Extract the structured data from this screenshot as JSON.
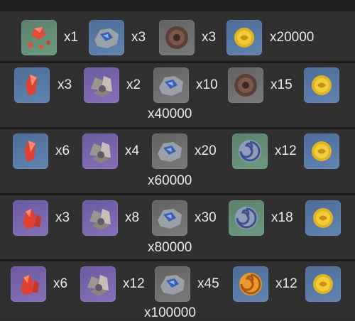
{
  "rows": [
    {
      "items": [
        {
          "icon": "gem-fragments-icon",
          "qty": "x1"
        },
        {
          "icon": "ore-chunk-icon",
          "qty": "x3"
        },
        {
          "icon": "brown-disc-icon",
          "qty": "x3"
        },
        {
          "icon": "mora-coin-icon",
          "qty": "x20000"
        }
      ]
    },
    {
      "items": [
        {
          "icon": "red-crystal-icon",
          "qty": "x3"
        },
        {
          "icon": "grey-ore-icon",
          "qty": "x2"
        },
        {
          "icon": "ore-chunk-icon",
          "qty": "x10"
        },
        {
          "icon": "brown-disc-icon",
          "qty": "x15"
        },
        {
          "icon": "mora-coin-icon",
          "qty": ""
        }
      ],
      "mora": "x40000"
    },
    {
      "items": [
        {
          "icon": "red-crystal-icon",
          "qty": "x6"
        },
        {
          "icon": "grey-ore-icon",
          "qty": "x4"
        },
        {
          "icon": "ore-chunk-icon",
          "qty": "x20"
        },
        {
          "icon": "swirl-disc-icon",
          "qty": "x12"
        },
        {
          "icon": "mora-coin-icon",
          "qty": ""
        }
      ],
      "mora": "x60000"
    },
    {
      "items": [
        {
          "icon": "red-crystal-cluster-icon",
          "qty": "x3"
        },
        {
          "icon": "grey-ore-icon",
          "qty": "x8"
        },
        {
          "icon": "ore-chunk-icon",
          "qty": "x30"
        },
        {
          "icon": "swirl-disc-icon",
          "qty": "x18"
        },
        {
          "icon": "mora-coin-icon",
          "qty": ""
        }
      ],
      "mora": "x80000"
    },
    {
      "items": [
        {
          "icon": "red-crystal-cluster-icon",
          "qty": "x6"
        },
        {
          "icon": "grey-ore-icon",
          "qty": "x12"
        },
        {
          "icon": "ore-chunk-icon",
          "qty": "x45"
        },
        {
          "icon": "orange-swirl-disc-icon",
          "qty": "x12"
        },
        {
          "icon": "mora-coin-icon",
          "qty": ""
        }
      ],
      "mora": "x100000"
    }
  ]
}
